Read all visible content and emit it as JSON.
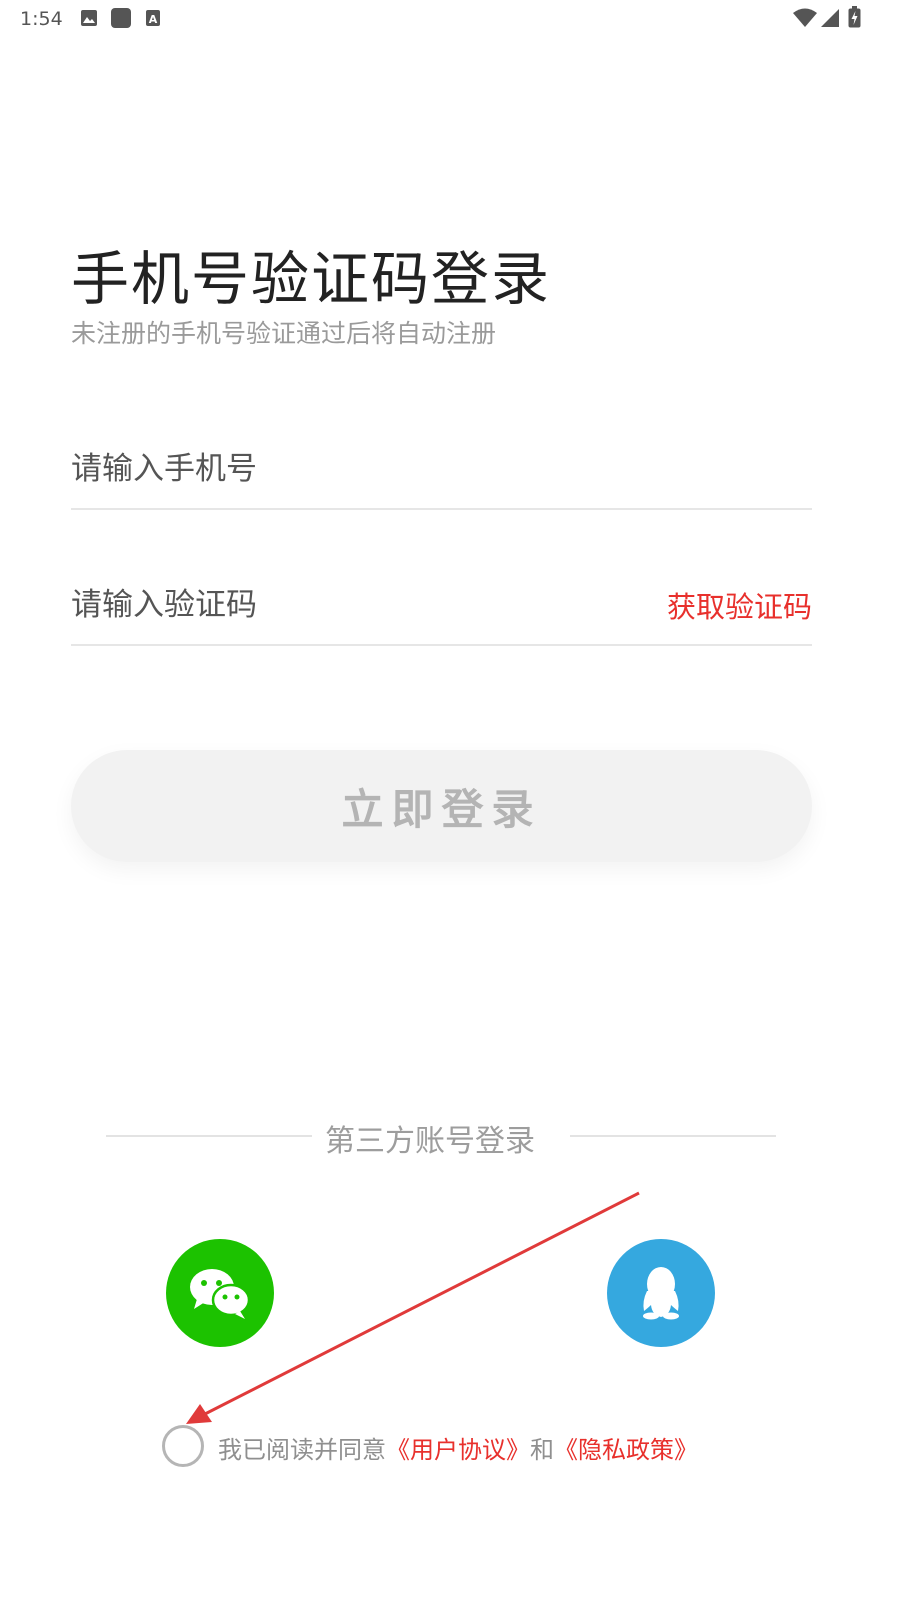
{
  "status_bar": {
    "time": "1:54",
    "left_icons": [
      "image-icon",
      "square-app-icon",
      "a-box-icon"
    ],
    "right_icons": [
      "wifi-icon",
      "signal-icon",
      "battery-charging-icon"
    ]
  },
  "header": {
    "title": "手机号验证码登录",
    "subtitle": "未注册的手机号验证通过后将自动注册"
  },
  "form": {
    "phone_placeholder": "请输入手机号",
    "code_placeholder": "请输入验证码",
    "get_code_label": "获取验证码",
    "login_label": "立即登录"
  },
  "third_party": {
    "label": "第三方账号登录",
    "wechat_icon": "wechat-icon",
    "qq_icon": "qq-penguin-icon"
  },
  "agreement": {
    "prefix": "我已阅读并同意",
    "user_agreement": "《用户协议》",
    "and": "和",
    "privacy_policy": "《隐私政策》"
  },
  "colors": {
    "accent_red": "#e8302c",
    "wechat_green": "#1cc200",
    "qq_blue": "#35a8df",
    "button_disabled_bg": "#f2f2f2",
    "button_disabled_text": "#b4b4b4",
    "annotation_arrow": "#e03a3a"
  }
}
